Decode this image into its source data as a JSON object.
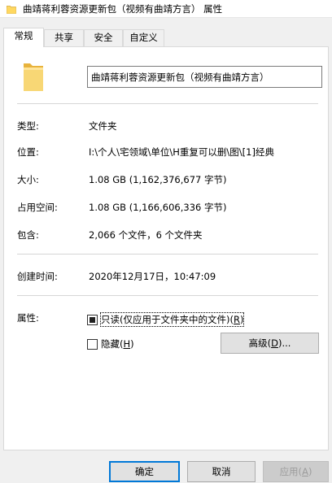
{
  "window": {
    "title": "曲靖蒋利蓉资源更新包（视频有曲靖方言） 属性"
  },
  "tabs": [
    {
      "label": "常规",
      "active": true
    },
    {
      "label": "共享",
      "active": false
    },
    {
      "label": "安全",
      "active": false
    },
    {
      "label": "自定义",
      "active": false
    }
  ],
  "general": {
    "folder_name": "曲靖蒋利蓉资源更新包（视频有曲靖方言）",
    "type_label": "类型:",
    "type_value": "文件夹",
    "location_label": "位置:",
    "location_value": "I:\\个人\\宅领域\\单位\\H重复可以删\\图\\[1]经典",
    "size_label": "大小:",
    "size_value": "1.08 GB (1,162,376,677 字节)",
    "disk_size_label": "占用空间:",
    "disk_size_value": "1.08 GB (1,166,606,336 字节)",
    "contains_label": "包含:",
    "contains_value": "2,066 个文件，6 个文件夹",
    "created_label": "创建时间:",
    "created_value": "2020年12月17日，10:47:09",
    "attributes_label": "属性:",
    "readonly_label_main": "只读(仅应用于文件夹中的文件)(",
    "readonly_key": "R",
    "readonly_close": ")",
    "hidden_label_main": "隐藏(",
    "hidden_key": "H",
    "hidden_close": ")",
    "advanced_main": "高级(",
    "advanced_key": "D",
    "advanced_close": ")..."
  },
  "buttons": {
    "ok": "确定",
    "cancel": "取消",
    "apply_main": "应用(",
    "apply_key": "A",
    "apply_close": ")"
  },
  "icons": {
    "title": "folder-icon",
    "general": "folder-icon"
  },
  "colors": {
    "folder": "#f8d775",
    "accent": "#0078d7"
  }
}
